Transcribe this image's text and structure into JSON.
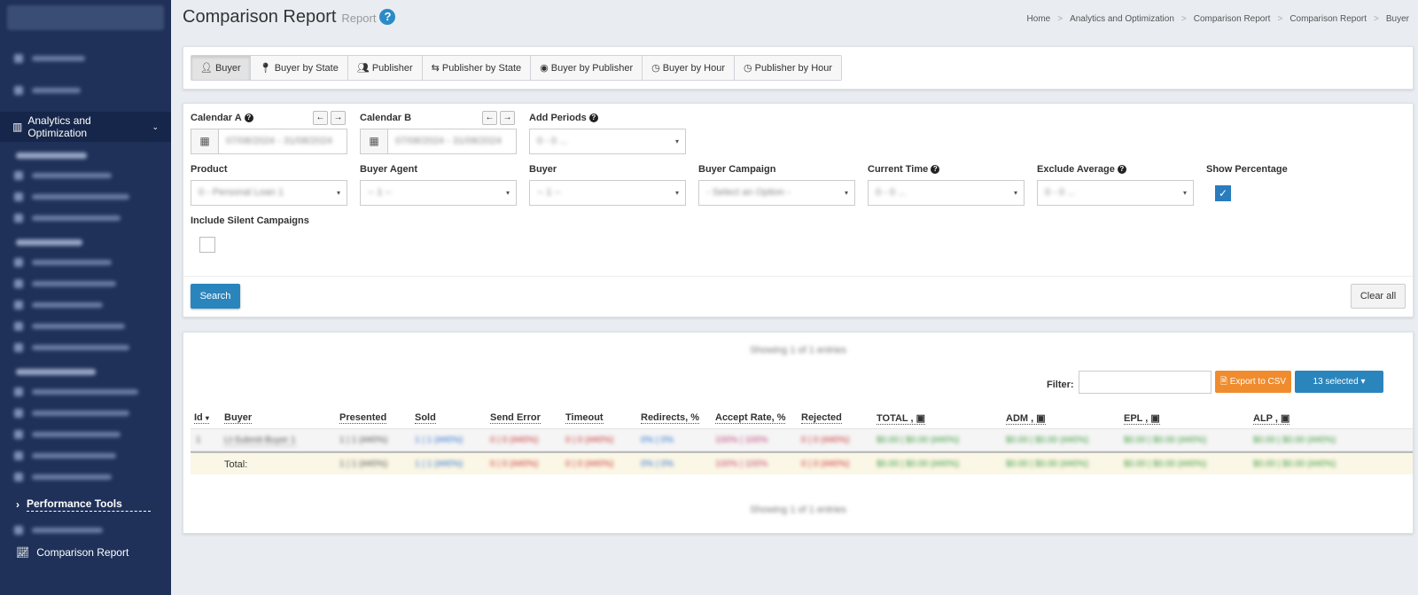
{
  "sidebar": {
    "active_item": "Analytics and Optimization",
    "section_tools": "Performance Tools",
    "current_page": "Comparison Report"
  },
  "header": {
    "title": "Comparison Report",
    "subtitle": "Report",
    "help": "?",
    "breadcrumb": [
      "Home",
      "Analytics and Optimization",
      "Comparison Report",
      "Comparison Report",
      "Buyer"
    ]
  },
  "tabs": [
    "Buyer",
    "Buyer by State",
    "Publisher",
    "Publisher by State",
    "Buyer by Publisher",
    "Buyer by Hour",
    "Publisher by Hour"
  ],
  "filters": {
    "calendar_a": "Calendar A",
    "calendar_a_value": "07/08/2024 - 31/08/2024",
    "calendar_b": "Calendar B",
    "calendar_b_value": "07/08/2024 - 31/08/2024",
    "add_periods": "Add Periods",
    "add_periods_value": "0 - 0 ...",
    "product": "Product",
    "product_value": "0 - Personal Loan 1",
    "buyer_agent": "Buyer Agent",
    "buyer_agent_value": "-- 1 --",
    "buyer": "Buyer",
    "buyer_value": "-- 1 --",
    "buyer_campaign": "Buyer Campaign",
    "buyer_campaign_value": "- Select an Option -",
    "current_time": "Current Time",
    "current_time_value": "0 - 0 ...",
    "exclude_average": "Exclude Average",
    "exclude_average_value": "0 - 0 ...",
    "show_percentage": "Show Percentage",
    "include_silent": "Include Silent Campaigns",
    "search": "Search",
    "clear_all": "Clear all"
  },
  "table": {
    "showing": "Showing 1 of 1 entries",
    "filter_label": "Filter:",
    "export_csv": "Export to CSV",
    "selected": "13 selected",
    "columns": [
      "Id",
      "Buyer",
      "Presented",
      "Sold",
      "Send Error",
      "Timeout",
      "Redirects, %",
      "Accept Rate, %",
      "Rejected",
      "TOTAL ,",
      "ADM ,",
      "EPL ,",
      "ALP ,"
    ],
    "row": {
      "id": "1",
      "buyer": "Lt-Submit-Buyer 1",
      "presented": "1 | 1 (##0%)",
      "sold": "1 | 1 (##0%)",
      "send_error": "0 | 0 (##0%)",
      "timeout": "0 | 0 (##0%)",
      "redirects": "0% | 0%",
      "accept": "100% | 100%",
      "rejected": "0 | 0 (##0%)",
      "total": "$0.00 | $0.00 (##0%)",
      "adm": "$0.00 | $0.00 (##0%)",
      "epl": "$0.00 | $0.00 (##0%)",
      "alp": "$0.00 | $0.00 (##0%)"
    },
    "total_label": "Total:"
  },
  "colors": {
    "accent": "#2a85bd",
    "sidebar": "#1f3159",
    "export": "#f08c2e"
  }
}
